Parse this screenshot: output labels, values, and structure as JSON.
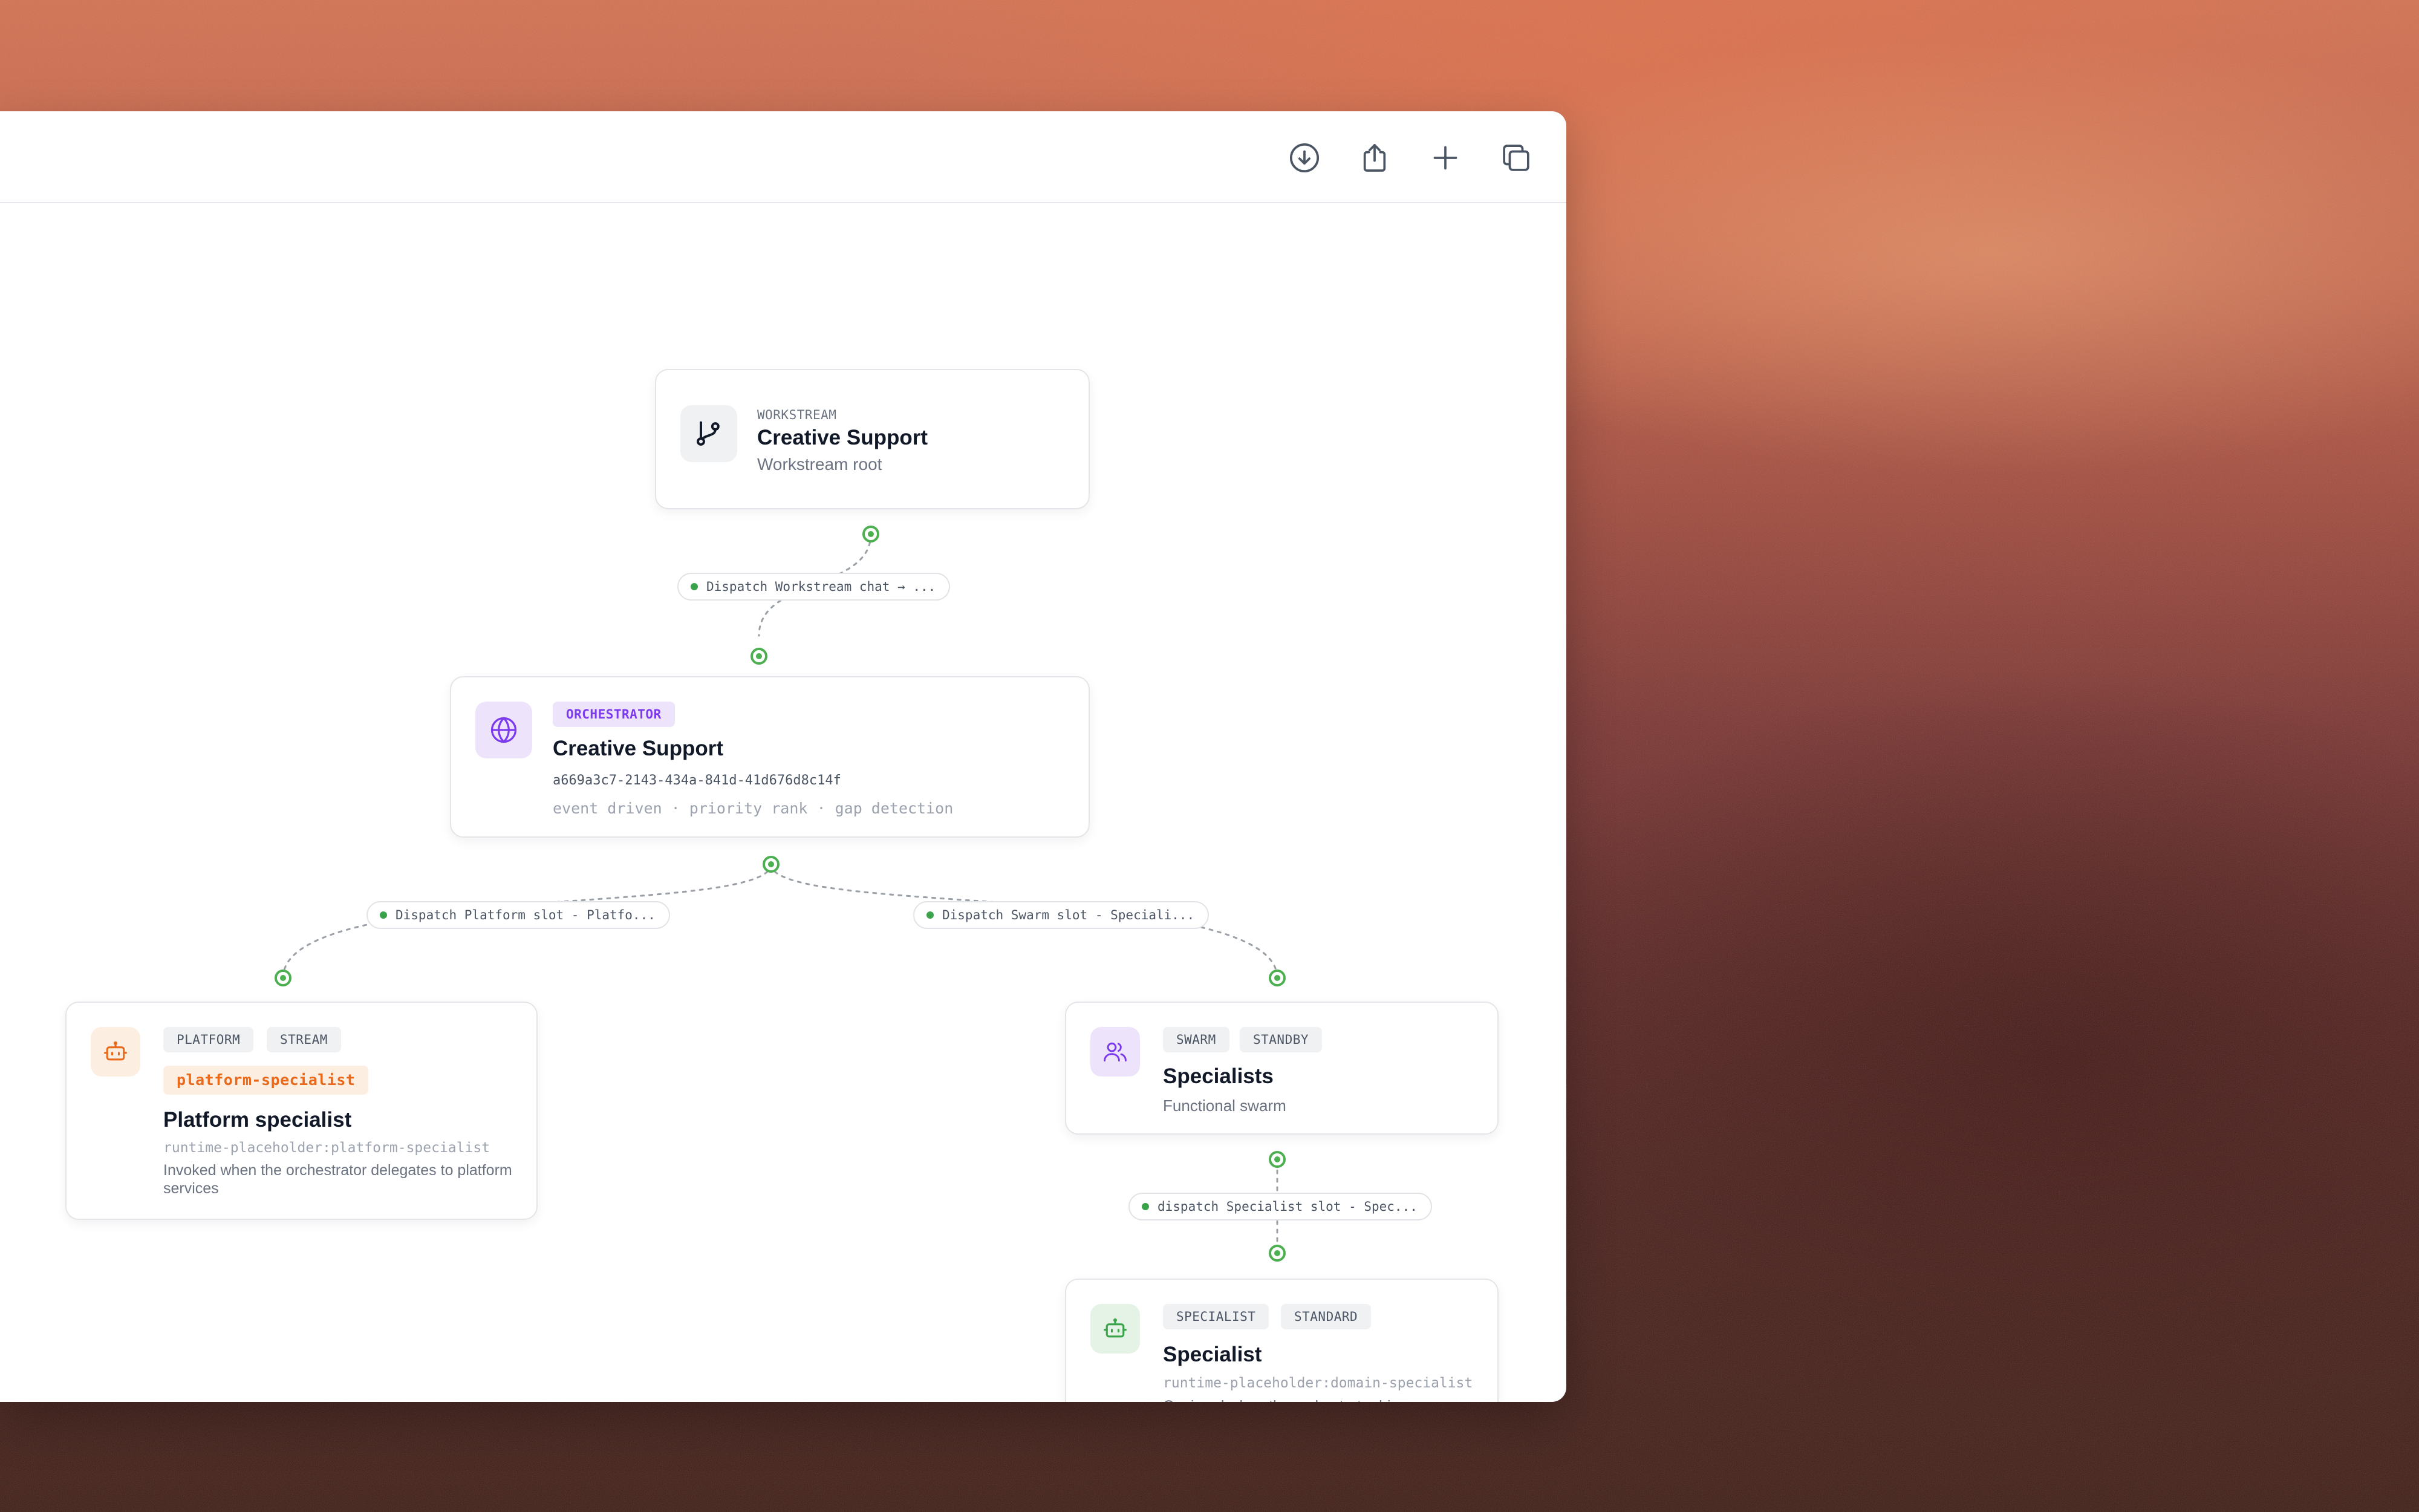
{
  "toolbar": {
    "download_icon": "download-icon",
    "share_icon": "share-icon",
    "add_icon": "plus-icon",
    "copy_icon": "copy-icon"
  },
  "nodes": {
    "workstream": {
      "eyebrow": "WORKSTREAM",
      "title": "Creative Support",
      "subtitle": "Workstream root",
      "icon": "branch-icon"
    },
    "orchestrator": {
      "badge": "ORCHESTRATOR",
      "title": "Creative Support",
      "id": "a669a3c7-2143-434a-841d-41d676d8c14f",
      "traits": "event driven · priority rank · gap detection",
      "icon": "globe-icon",
      "accent": "#7c3aed"
    },
    "platform": {
      "tags": [
        "PLATFORM",
        "STREAM"
      ],
      "slug": "platform-specialist",
      "title": "Platform specialist",
      "runtime": "runtime-placeholder:platform-specialist",
      "description": "Invoked when the orchestrator delegates to platform services",
      "icon": "bot-icon",
      "accent": "#ea6a1c"
    },
    "swarm": {
      "tags": [
        "SWARM",
        "STANDBY"
      ],
      "title": "Specialists",
      "subtitle": "Functional swarm",
      "icon": "users-icon",
      "accent": "#7c3aed"
    },
    "specialist": {
      "tags": [
        "SPECIALIST",
        "STANDARD"
      ],
      "title": "Specialist",
      "runtime": "runtime-placeholder:domain-specialist",
      "description": "Conjured when the orchestrator hires a functional swarm",
      "icon": "bot-icon",
      "accent": "#3aa34a"
    }
  },
  "edges": [
    {
      "label": "Dispatch Workstream chat → ..."
    },
    {
      "label": "Dispatch Platform slot - Platfo..."
    },
    {
      "label": "Dispatch Swarm slot - Speciali..."
    },
    {
      "label": "dispatch Specialist slot - Spec..."
    }
  ],
  "colors": {
    "port": "#4caf50",
    "edge_dot": "#3aa34a"
  }
}
